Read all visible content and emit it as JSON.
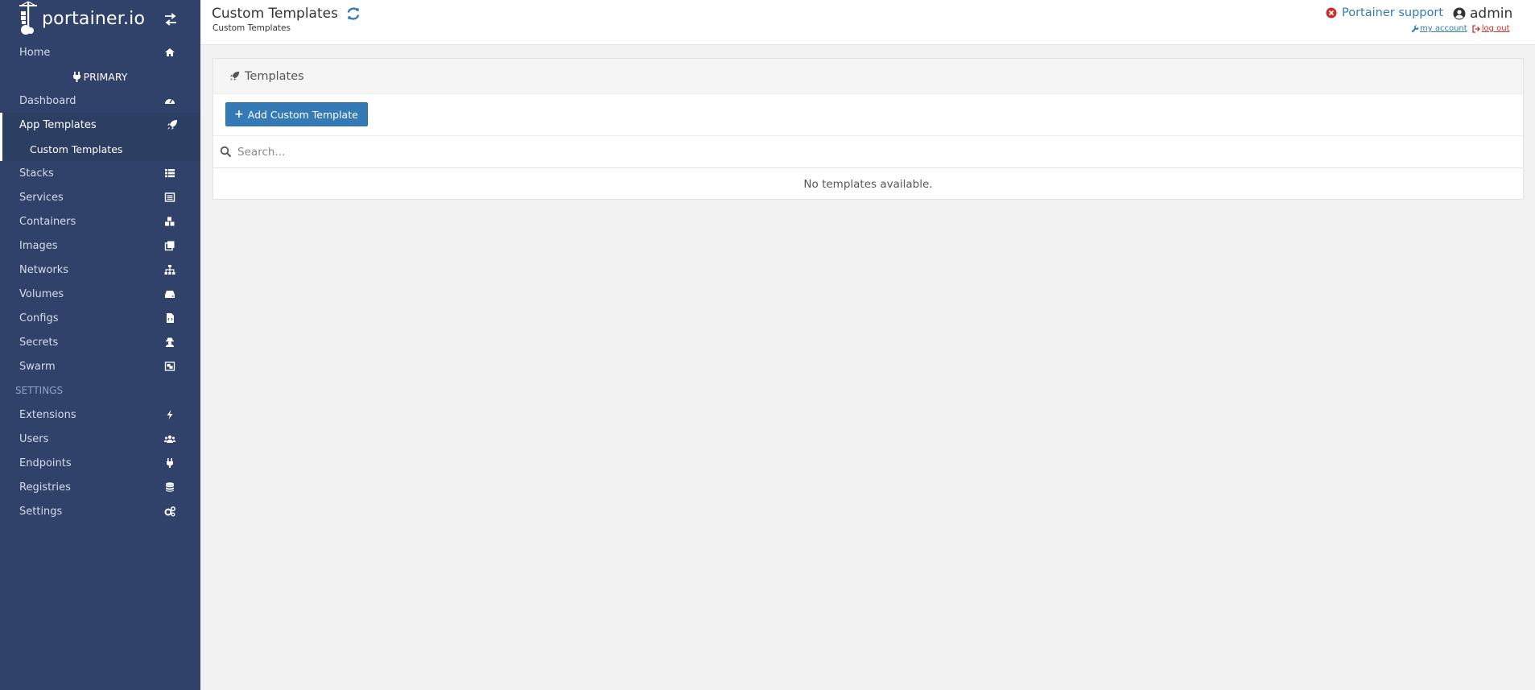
{
  "brand": {
    "name": "portainer.io"
  },
  "sidebar": {
    "home": "Home",
    "endpoint": "PRIMARY",
    "items": [
      {
        "label": "Dashboard",
        "icon": "tachometer-icon"
      },
      {
        "label": "App Templates",
        "icon": "rocket-icon"
      },
      {
        "label": "Custom Templates",
        "icon": ""
      },
      {
        "label": "Stacks",
        "icon": "th-list-icon"
      },
      {
        "label": "Services",
        "icon": "list-alt-icon"
      },
      {
        "label": "Containers",
        "icon": "cubes-icon"
      },
      {
        "label": "Images",
        "icon": "clone-icon"
      },
      {
        "label": "Networks",
        "icon": "sitemap-icon"
      },
      {
        "label": "Volumes",
        "icon": "hdd-icon"
      },
      {
        "label": "Configs",
        "icon": "file-code-icon"
      },
      {
        "label": "Secrets",
        "icon": "user-secret-icon"
      },
      {
        "label": "Swarm",
        "icon": "object-group-icon"
      }
    ],
    "settings_header": "SETTINGS",
    "settings_items": [
      {
        "label": "Extensions",
        "icon": "bolt-icon"
      },
      {
        "label": "Users",
        "icon": "users-icon"
      },
      {
        "label": "Endpoints",
        "icon": "plug-icon"
      },
      {
        "label": "Registries",
        "icon": "database-icon"
      },
      {
        "label": "Settings",
        "icon": "cogs-icon"
      }
    ]
  },
  "header": {
    "title": "Custom Templates",
    "breadcrumb": "Custom Templates",
    "support": "Portainer support",
    "username": "admin",
    "my_account": "my account",
    "log_out": "log out"
  },
  "widget": {
    "title": "Templates",
    "add_button": "Add Custom Template",
    "search_placeholder": "Search...",
    "empty_message": "No templates available."
  },
  "colors": {
    "sidebar_bg": "#30426a",
    "primary": "#337ab7",
    "danger": "#c9302c"
  }
}
